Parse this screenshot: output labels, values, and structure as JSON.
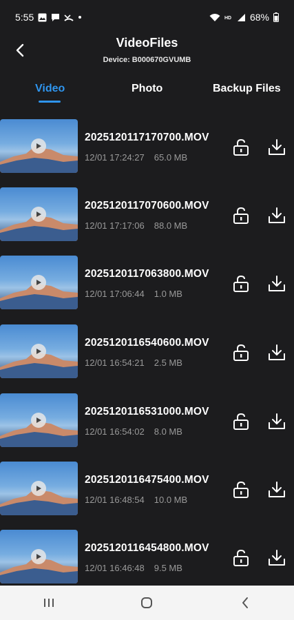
{
  "status": {
    "time": "5:55",
    "battery": "68%",
    "icons_left": [
      "image-icon",
      "chat-icon",
      "missed-call-icon",
      "dot-icon"
    ],
    "icons_right": [
      "wifi-icon",
      "hd-icon",
      "signal-icon",
      "battery-icon"
    ]
  },
  "header": {
    "title": "VideoFiles",
    "device": "Device: B000670GVUMB"
  },
  "tabs": [
    {
      "label": "Video",
      "active": true
    },
    {
      "label": "Photo",
      "active": false
    },
    {
      "label": "Backup Files",
      "active": false
    }
  ],
  "colors": {
    "accent": "#2f95ee",
    "background": "#1c1c1e",
    "meta": "#9a9a9a"
  },
  "files": [
    {
      "name": "2025120117170700.MOV",
      "time": "12/01 17:24:27",
      "size": "65.0 MB"
    },
    {
      "name": "2025120117070600.MOV",
      "time": "12/01 17:17:06",
      "size": "88.0 MB"
    },
    {
      "name": "2025120117063800.MOV",
      "time": "12/01 17:06:44",
      "size": "1.0 MB"
    },
    {
      "name": "2025120116540600.MOV",
      "time": "12/01 16:54:21",
      "size": "2.5 MB"
    },
    {
      "name": "2025120116531000.MOV",
      "time": "12/01 16:54:02",
      "size": "8.0 MB"
    },
    {
      "name": "2025120116475400.MOV",
      "time": "12/01 16:48:54",
      "size": "10.0 MB"
    },
    {
      "name": "2025120116454800.MOV",
      "time": "12/01 16:46:48",
      "size": "9.5 MB"
    }
  ],
  "navbar": [
    "recents-icon",
    "home-icon",
    "back-icon"
  ]
}
